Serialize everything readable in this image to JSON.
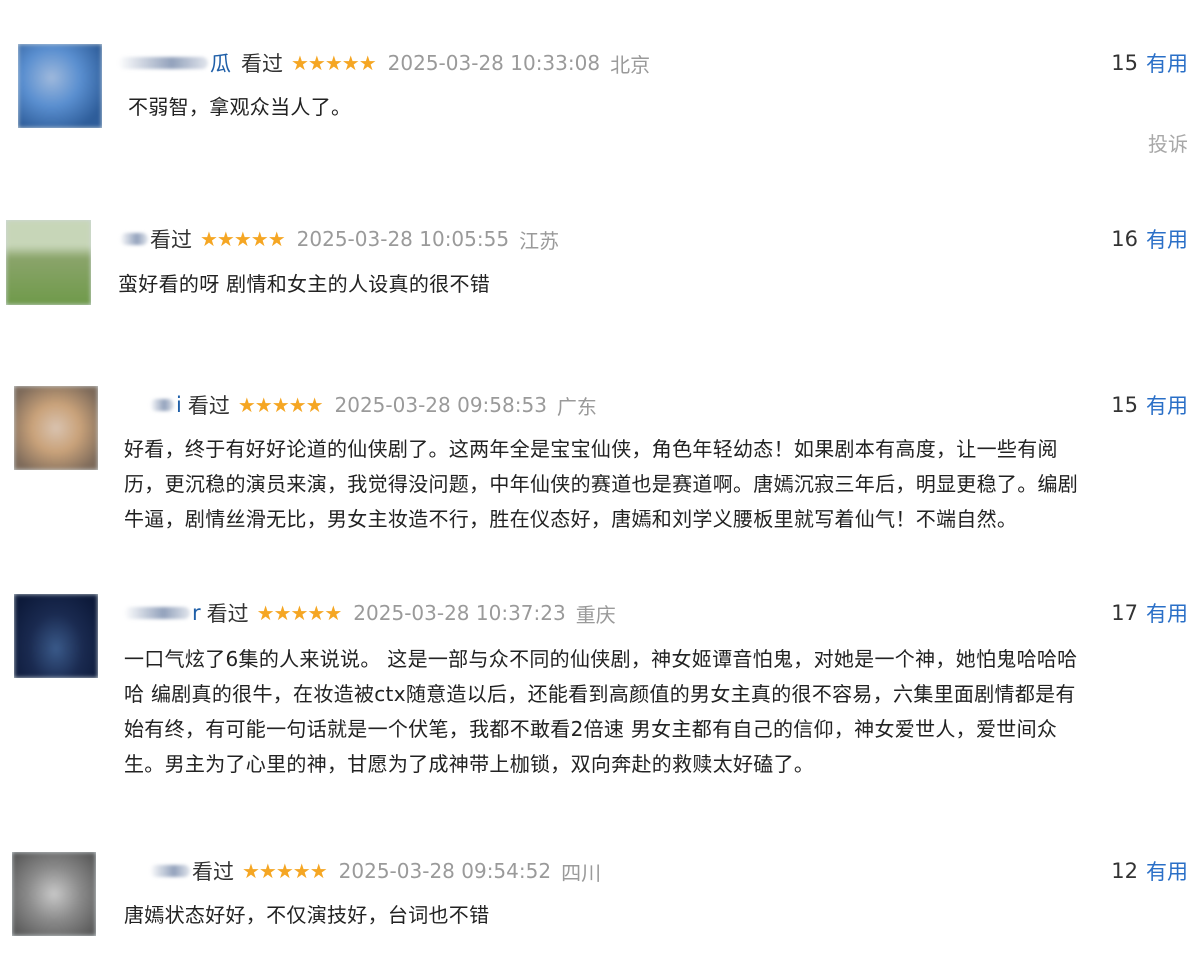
{
  "comments": [
    {
      "username_suffix": "瓜",
      "status": "看过",
      "rating": 5,
      "stars": "★★★★★",
      "time": "2025-03-28 10:33:08",
      "location": "北京",
      "useful_count": "15",
      "useful_label": "有用",
      "text": "不弱智，拿观众当人了。",
      "report_label": "投诉",
      "avatar_colors": [
        "#5a8fd0",
        "#2e5d9a",
        "#9fb9dc"
      ]
    },
    {
      "username_suffix": "",
      "status": "看过",
      "rating": 5,
      "stars": "★★★★★",
      "time": "2025-03-28 10:05:55",
      "location": "江苏",
      "useful_count": "16",
      "useful_label": "有用",
      "text": "蛮好看的呀 剧情和女主的人设真的很不错",
      "avatar_colors": [
        "#6f9a4a",
        "#c7d6b8",
        "#8aa46a"
      ]
    },
    {
      "username_suffix": "i",
      "status": "看过",
      "rating": 5,
      "stars": "★★★★★",
      "time": "2025-03-28 09:58:53",
      "location": "广东",
      "useful_count": "15",
      "useful_label": "有用",
      "text_lines": [
        "好看，终于有好好论道的仙侠剧了。这两年全是宝宝仙侠，角色年轻幼态！如果剧本有高度，让一些有阅",
        "历，更沉稳的演员来演，我觉得没问题，中年仙侠的赛道也是赛道啊。唐嫣沉寂三年后，明显更稳了。编剧",
        "牛逼，剧情丝滑无比，男女主妆造不行，胜在仪态好，唐嫣和刘学义腰板里就写着仙气！不端自然。"
      ],
      "avatar_colors": [
        "#c9a27a",
        "#7d6a5a",
        "#d9c3b0"
      ]
    },
    {
      "username_suffix": "r",
      "status": "看过",
      "rating": 5,
      "stars": "★★★★★",
      "time": "2025-03-28 10:37:23",
      "location": "重庆",
      "useful_count": "17",
      "useful_label": "有用",
      "text_lines": [
        "一口气炫了6集的人来说说。 这是一部与众不同的仙侠剧，神女姬谭音怕鬼，对她是一个神，她怕鬼哈哈哈",
        "哈 编剧真的很牛，在妆造被ctx随意造以后，还能看到高颜值的男女主真的很不容易，六集里面剧情都是有",
        "始有终，有可能一句话就是一个伏笔，我都不敢看2倍速 男女主都有自己的信仰，神女爱世人，爱世间众",
        "生。男主为了心里的神，甘愿为了成神带上枷锁，双向奔赴的救赎太好磕了。"
      ],
      "avatar_colors": [
        "#0d1a3a",
        "#3a5a8a",
        "#1a2a50"
      ]
    },
    {
      "username_suffix": "",
      "status": "看过",
      "rating": 5,
      "stars": "★★★★★",
      "time": "2025-03-28 09:54:52",
      "location": "四川",
      "useful_count": "12",
      "useful_label": "有用",
      "text": "唐嫣状态好好，不仅演技好，台词也不错",
      "avatar_colors": [
        "#8a8a8a",
        "#c8c8c8",
        "#5a5a5a"
      ]
    }
  ]
}
